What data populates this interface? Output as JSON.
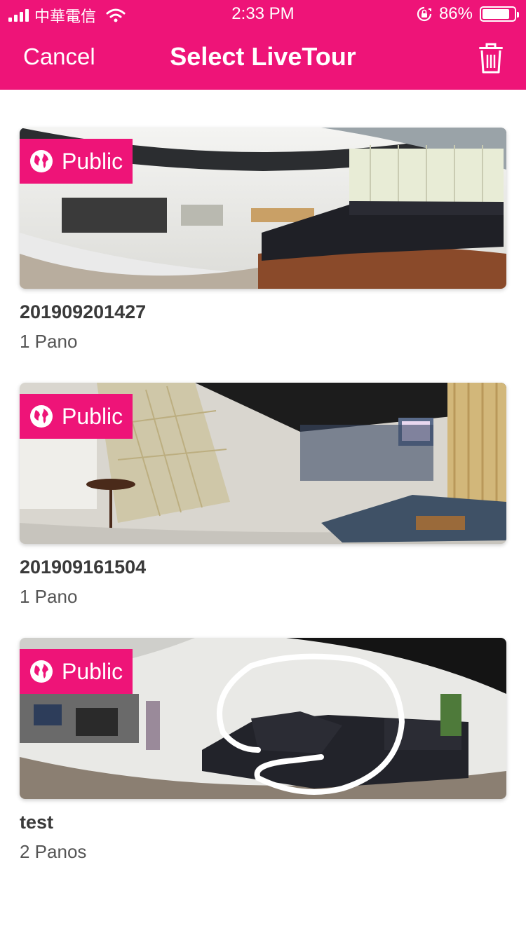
{
  "status": {
    "carrier": "中華電信",
    "time": "2:33 PM",
    "battery": "86%",
    "battery_level": 0.86
  },
  "nav": {
    "cancel_label": "Cancel",
    "title": "Select LiveTour",
    "delete_icon": "trash-icon"
  },
  "colors": {
    "accent": "#ee1478"
  },
  "tours": [
    {
      "badge": "Public",
      "name": "201909201427",
      "panos": "1 Pano"
    },
    {
      "badge": "Public",
      "name": "201909161504",
      "panos": "1 Pano"
    },
    {
      "badge": "Public",
      "name": "test",
      "panos": "2 Panos"
    }
  ]
}
